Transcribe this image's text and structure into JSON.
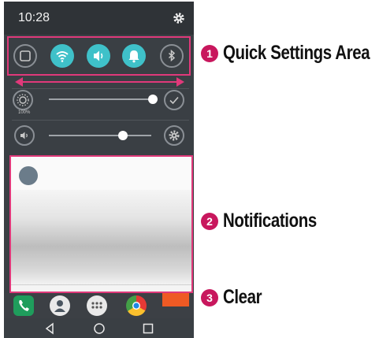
{
  "status_bar": {
    "time": "10:28",
    "settings_icon": "gear-icon"
  },
  "quick_settings": [
    {
      "name": "qs-screen-capture",
      "icon": "square-icon",
      "state": "off"
    },
    {
      "name": "qs-wifi",
      "icon": "wifi-icon",
      "state": "on"
    },
    {
      "name": "qs-sound",
      "icon": "speaker-icon",
      "state": "on"
    },
    {
      "name": "qs-notifications",
      "icon": "bell-icon",
      "state": "on"
    },
    {
      "name": "qs-bluetooth",
      "icon": "bluetooth-icon",
      "state": "off"
    }
  ],
  "brightness": {
    "level_label": "100%",
    "level": 1.0,
    "auto_icon": "checkmark-icon"
  },
  "volume": {
    "level": 0.72,
    "settings_icon": "gear-icon"
  },
  "dock": [
    "phone-icon",
    "contacts-icon",
    "apps-icon",
    "chrome-icon"
  ],
  "navbar": [
    "back-icon",
    "home-icon",
    "recents-icon"
  ],
  "annotations": [
    {
      "number": "1",
      "text": "Quick Settings Area"
    },
    {
      "number": "2",
      "text": "Notifications"
    },
    {
      "number": "3",
      "text": "Clear"
    }
  ],
  "colors": {
    "accent": "#3fc1c9",
    "callout": "#e0397a",
    "badge": "#c8175d",
    "clear": "#ee5a24"
  }
}
